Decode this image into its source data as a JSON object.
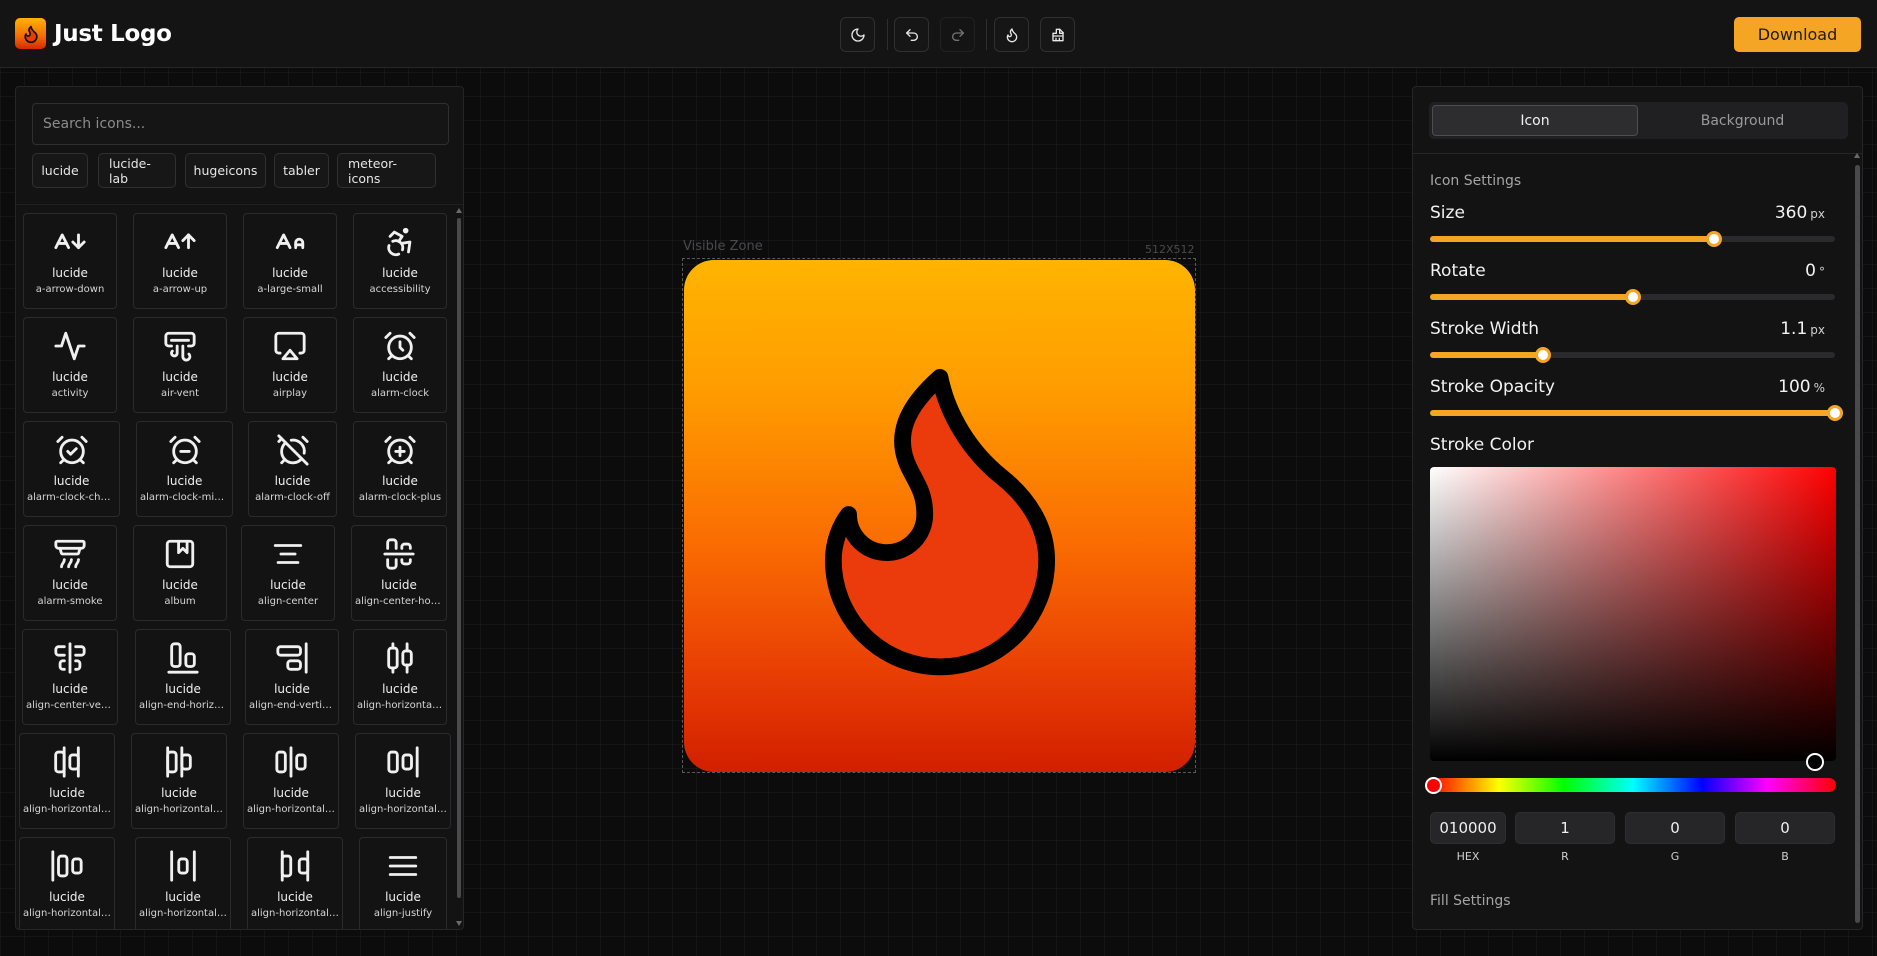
{
  "app": {
    "name": "Just Logo"
  },
  "toolbar": {
    "theme_icon": "moon-icon",
    "undo_icon": "undo-icon",
    "redo_icon": "redo-icon",
    "preset_icon": "flame-icon",
    "clear_icon": "brush-icon",
    "download_label": "Download"
  },
  "sidebar": {
    "search_placeholder": "Search icons...",
    "libraries": [
      "lucide",
      "lucide-lab",
      "hugeicons",
      "tabler",
      "meteor-icons"
    ],
    "icons": [
      {
        "library": "lucide",
        "name": "a-arrow-down"
      },
      {
        "library": "lucide",
        "name": "a-arrow-up"
      },
      {
        "library": "lucide",
        "name": "a-large-small"
      },
      {
        "library": "lucide",
        "name": "accessibility"
      },
      {
        "library": "lucide",
        "name": "activity"
      },
      {
        "library": "lucide",
        "name": "air-vent"
      },
      {
        "library": "lucide",
        "name": "airplay"
      },
      {
        "library": "lucide",
        "name": "alarm-clock"
      },
      {
        "library": "lucide",
        "name": "alarm-clock-check"
      },
      {
        "library": "lucide",
        "name": "alarm-clock-minus"
      },
      {
        "library": "lucide",
        "name": "alarm-clock-off"
      },
      {
        "library": "lucide",
        "name": "alarm-clock-plus"
      },
      {
        "library": "lucide",
        "name": "alarm-smoke"
      },
      {
        "library": "lucide",
        "name": "album"
      },
      {
        "library": "lucide",
        "name": "align-center"
      },
      {
        "library": "lucide",
        "name": "align-center-hori..."
      },
      {
        "library": "lucide",
        "name": "align-center-verti..."
      },
      {
        "library": "lucide",
        "name": "align-end-horizon..."
      },
      {
        "library": "lucide",
        "name": "align-end-vertical"
      },
      {
        "library": "lucide",
        "name": "align-horizontal-..."
      },
      {
        "library": "lucide",
        "name": "align-horizontal-..."
      },
      {
        "library": "lucide",
        "name": "align-horizontal-..."
      },
      {
        "library": "lucide",
        "name": "align-horizontal-j..."
      },
      {
        "library": "lucide",
        "name": "align-horizontal-j..."
      },
      {
        "library": "lucide",
        "name": "align-horizontal-j..."
      },
      {
        "library": "lucide",
        "name": "align-horizontal-s..."
      },
      {
        "library": "lucide",
        "name": "align-horizontal-s..."
      },
      {
        "library": "lucide",
        "name": "align-justify"
      }
    ]
  },
  "canvas": {
    "zone_label": "Visible Zone",
    "size_label": "512X512",
    "background_gradient": [
      "#ffb400",
      "#d21f00"
    ],
    "icon": "flame-icon",
    "icon_fill": "#eb3a0b",
    "icon_stroke": "#010000"
  },
  "settings": {
    "tabs": {
      "icon": "Icon",
      "background": "Background"
    },
    "icon_settings_title": "Icon Settings",
    "size": {
      "label": "Size",
      "value": "360",
      "unit": "px",
      "fraction": 0.7
    },
    "rotate": {
      "label": "Rotate",
      "value": "0",
      "unit": "°",
      "fraction": 0.5
    },
    "stroke_width": {
      "label": "Stroke Width",
      "value": "1.1",
      "unit": "px",
      "fraction": 0.28
    },
    "stroke_opacity": {
      "label": "Stroke Opacity",
      "value": "100",
      "unit": "%",
      "fraction": 1.0
    },
    "stroke_color": {
      "label": "Stroke Color",
      "hex": "010000",
      "r": "1",
      "g": "0",
      "b": "0",
      "hex_label": "HEX",
      "r_label": "R",
      "g_label": "G",
      "b_label": "B"
    },
    "fill_settings_title": "Fill Settings"
  },
  "colors": {
    "accent": "#f5a524",
    "panel": "#131314",
    "background": "#0c0c0d"
  }
}
